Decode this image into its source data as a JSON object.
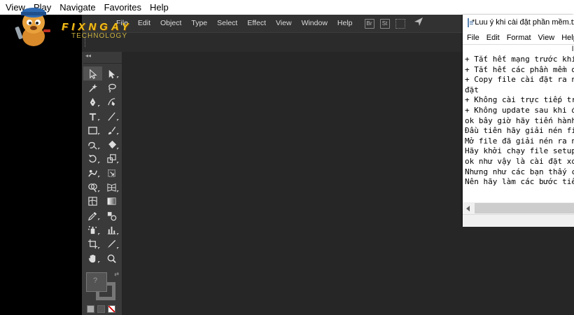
{
  "player_menu": [
    "View",
    "Play",
    "Navigate",
    "Favorites",
    "Help"
  ],
  "logo": {
    "name": "FIXNGAY",
    "sub": "TECHNOLOGY"
  },
  "illustrator": {
    "menu": [
      "File",
      "Edit",
      "Object",
      "Type",
      "Select",
      "Effect",
      "View",
      "Window",
      "Help"
    ],
    "mini_icons": [
      "Br",
      "St"
    ],
    "toolbar_collapse": "◂◂",
    "fill_placeholder": "?",
    "swap_icon": "⇄"
  },
  "tools": [
    "selection-tool",
    "direct-selection-tool",
    "magic-wand-tool",
    "lasso-tool",
    "pen-tool",
    "curvature-tool",
    "type-tool",
    "line-segment-tool",
    "rectangle-tool",
    "paintbrush-tool",
    "shaper-tool",
    "eraser-tool",
    "rotate-tool",
    "scale-tool",
    "warp-tool",
    "free-transform-tool",
    "shape-builder-tool",
    "perspective-grid-tool",
    "mesh-tool",
    "gradient-tool",
    "eyedropper-tool",
    "blend-tool",
    "symbol-sprayer-tool",
    "column-graph-tool",
    "artboard-tool",
    "slice-tool",
    "hand-tool",
    "zoom-tool"
  ],
  "notepad": {
    "title": "*Luu ý khi cài đặt phần mềm.txt",
    "menu": [
      "File",
      "Edit",
      "Format",
      "View",
      "Help"
    ],
    "lines": [
      "+ Tắt hết mạng trước khi",
      "+ Tắt hết các phần mềm di",
      "+ Copy file cài đặt ra n",
      "đặt",
      "+ Không cài trực tiếp trê",
      "+ Không update sau khi đã",
      "ok bây giờ hãy tiến hành",
      "Đầu tiên hãy giải nén fil",
      "Mở file đã giải nén ra nh",
      "Hãy khởi chạy file setup",
      "ok như vậy là cài đặt xon",
      "Nhưng như các bạn thấy cả",
      "Nên hãy làm các bước tiếp"
    ],
    "cursor_marker": "l"
  }
}
